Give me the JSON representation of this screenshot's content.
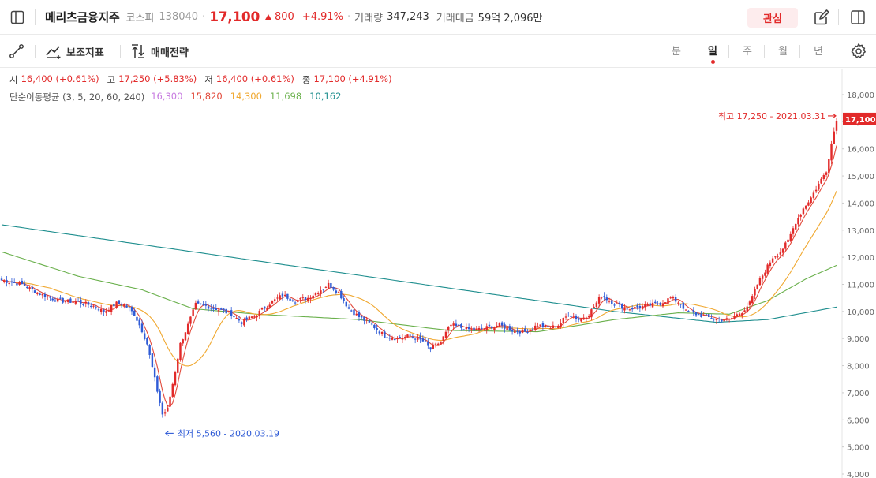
{
  "header": {
    "stock_name": "메리츠금융지주",
    "market": "코스피",
    "code": "138040",
    "price": "17,100",
    "change": "800",
    "change_pct": "+4.91%",
    "volume_label": "거래량",
    "volume": "347,243",
    "amount_label": "거래대금",
    "amount": "59억 2,096만",
    "favorite_label": "관심"
  },
  "toolbar": {
    "indicator_label": "보조지표",
    "strategy_label": "매매전략",
    "periods": [
      "분",
      "일",
      "주",
      "월",
      "년"
    ],
    "active_period": "일"
  },
  "ohlc": {
    "open_label": "시",
    "open": "16,400 (+0.61%)",
    "high_label": "고",
    "high": "17,250 (+5.83%)",
    "low_label": "저",
    "low": "16,400 (+0.61%)",
    "close_label": "종",
    "close": "17,100 (+4.91%)"
  },
  "ma": {
    "label": "단순이동평균 (3, 5, 20, 60, 240)",
    "values": [
      "16,300",
      "15,820",
      "14,300",
      "11,698",
      "10,162"
    ],
    "colors": [
      "#c77be0",
      "#e24a3b",
      "#f0a830",
      "#6ab04c",
      "#1e8e8e"
    ]
  },
  "colors": {
    "up": "#e22a2a",
    "down": "#2f5bd6",
    "accent": "#e22a2a"
  },
  "chart_data": {
    "type": "candlestick",
    "y_ticks": [
      "18,000",
      "17,000",
      "16,000",
      "15,000",
      "14,000",
      "13,000",
      "12,000",
      "11,000",
      "10,000",
      "9,000",
      "8,000",
      "7,000",
      "6,000",
      "5,000",
      "4,000"
    ],
    "ylim": [
      4000,
      18000
    ],
    "x_range": [
      "2020-03-19",
      "2021-03-31"
    ],
    "last_price_label": "17,100",
    "high_annotation": "최고 17,250 - 2021.03.31",
    "low_annotation": "최저 5,560 - 2020.03.19",
    "price_path": [
      [
        0,
        11150
      ],
      [
        8,
        11000
      ],
      [
        15,
        10650
      ],
      [
        22,
        10400
      ],
      [
        30,
        10350
      ],
      [
        36,
        10200
      ],
      [
        40,
        10000
      ],
      [
        42,
        10100
      ],
      [
        45,
        10300
      ],
      [
        48,
        10250
      ],
      [
        52,
        9900
      ],
      [
        55,
        9300
      ],
      [
        57,
        8800
      ],
      [
        60,
        7500
      ],
      [
        63,
        6200
      ],
      [
        65,
        6400
      ],
      [
        68,
        7800
      ],
      [
        70,
        8800
      ],
      [
        73,
        9500
      ],
      [
        76,
        10250
      ],
      [
        80,
        10200
      ],
      [
        84,
        10100
      ],
      [
        90,
        9900
      ],
      [
        94,
        9600
      ],
      [
        100,
        9900
      ],
      [
        105,
        10300
      ],
      [
        110,
        10600
      ],
      [
        115,
        10400
      ],
      [
        120,
        10500
      ],
      [
        125,
        10800
      ],
      [
        128,
        11000
      ],
      [
        132,
        10700
      ],
      [
        136,
        10100
      ],
      [
        140,
        9800
      ],
      [
        145,
        9500
      ],
      [
        150,
        9100
      ],
      [
        155,
        9000
      ],
      [
        160,
        9100
      ],
      [
        165,
        8900
      ],
      [
        168,
        8600
      ],
      [
        172,
        8900
      ],
      [
        176,
        9500
      ],
      [
        180,
        9400
      ],
      [
        185,
        9300
      ],
      [
        190,
        9400
      ],
      [
        195,
        9500
      ],
      [
        200,
        9300
      ],
      [
        205,
        9250
      ],
      [
        210,
        9500
      ],
      [
        215,
        9400
      ],
      [
        218,
        9500
      ],
      [
        222,
        9900
      ],
      [
        226,
        9700
      ],
      [
        230,
        9900
      ],
      [
        235,
        10600
      ],
      [
        238,
        10400
      ],
      [
        242,
        10200
      ],
      [
        246,
        10100
      ],
      [
        252,
        10200
      ],
      [
        258,
        10300
      ],
      [
        262,
        10500
      ],
      [
        266,
        10300
      ],
      [
        268,
        10000
      ],
      [
        272,
        9900
      ],
      [
        276,
        9800
      ],
      [
        280,
        9700
      ],
      [
        285,
        9700
      ],
      [
        290,
        10000
      ],
      [
        293,
        10300
      ],
      [
        296,
        11000
      ],
      [
        299,
        11500
      ],
      [
        302,
        12000
      ],
      [
        305,
        12200
      ],
      [
        308,
        12600
      ],
      [
        311,
        13300
      ],
      [
        314,
        13800
      ],
      [
        317,
        14200
      ],
      [
        320,
        14700
      ],
      [
        323,
        15200
      ],
      [
        325,
        16200
      ],
      [
        327,
        17100
      ]
    ],
    "ma_paths": [
      [
        [
          0,
          12200
        ],
        [
          30,
          11300
        ],
        [
          55,
          10800
        ],
        [
          75,
          10100
        ],
        [
          100,
          9900
        ],
        [
          140,
          9700
        ],
        [
          175,
          9300
        ],
        [
          210,
          9250
        ],
        [
          240,
          9700
        ],
        [
          265,
          9950
        ],
        [
          285,
          9900
        ],
        [
          300,
          10400
        ],
        [
          315,
          11200
        ],
        [
          327,
          11700
        ]
      ],
      [
        [
          0,
          13200
        ],
        [
          60,
          12400
        ],
        [
          120,
          11600
        ],
        [
          180,
          10800
        ],
        [
          240,
          10000
        ],
        [
          280,
          9600
        ],
        [
          300,
          9700
        ],
        [
          327,
          10162
        ]
      ]
    ]
  }
}
